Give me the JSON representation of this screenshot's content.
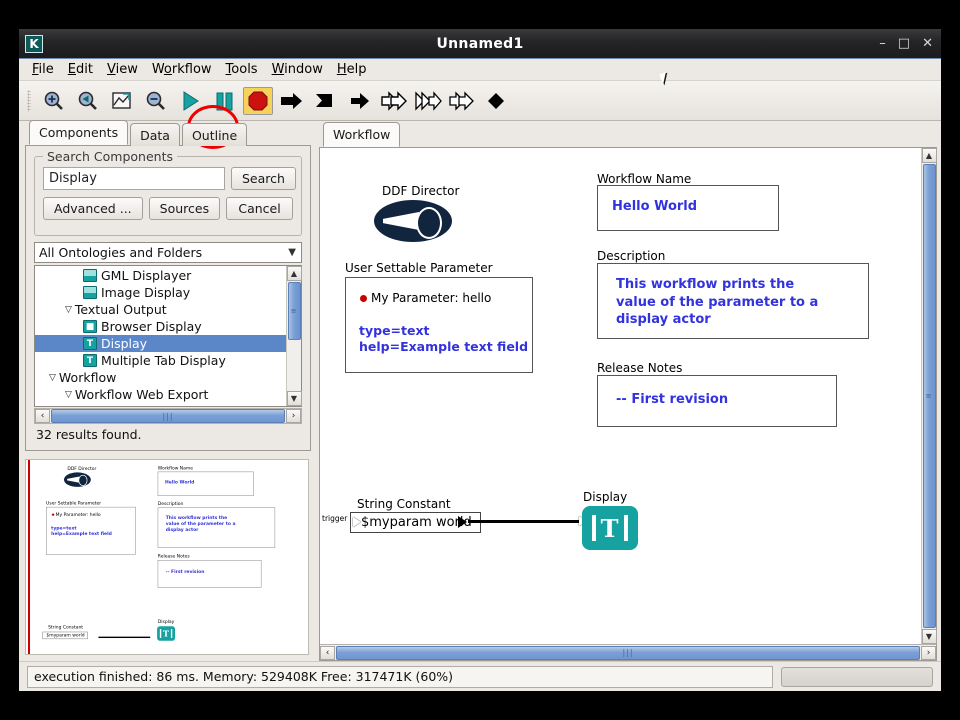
{
  "window": {
    "title": "Unnamed1",
    "app_icon": "K",
    "minimize": "–",
    "maximize": "□",
    "close": "✕"
  },
  "menubar": [
    {
      "label": "File",
      "mnemonic": "F"
    },
    {
      "label": "Edit",
      "mnemonic": "E"
    },
    {
      "label": "View",
      "mnemonic": "V"
    },
    {
      "label": "Workflow",
      "mnemonic": "W"
    },
    {
      "label": "Tools",
      "mnemonic": "T"
    },
    {
      "label": "Window",
      "mnemonic": "W"
    },
    {
      "label": "Help",
      "mnemonic": "H"
    }
  ],
  "toolbar": {
    "buttons": [
      {
        "name": "zoom-in-icon",
        "tip": "Zoom In"
      },
      {
        "name": "zoom-back-icon",
        "tip": "Zoom Reset"
      },
      {
        "name": "zoom-fit-icon",
        "tip": "Zoom Fit"
      },
      {
        "name": "zoom-out-icon",
        "tip": "Zoom Out"
      },
      {
        "name": "run-icon",
        "tip": "Run"
      },
      {
        "name": "pause-icon",
        "tip": "Pause"
      },
      {
        "name": "stop-icon",
        "tip": "Stop"
      },
      {
        "name": "step-icon",
        "tip": "Step"
      },
      {
        "name": "flag-icon",
        "tip": "Run to Breakpoint"
      },
      {
        "name": "step-into-icon",
        "tip": "Step Into"
      },
      {
        "name": "double-arrow-icon",
        "tip": "Step Over"
      },
      {
        "name": "skip-icon",
        "tip": "Skip"
      },
      {
        "name": "fast-forward-icon",
        "tip": "Fast Forward"
      },
      {
        "name": "diamond-icon",
        "tip": "Breakpoint"
      }
    ],
    "highlight_color": "#ee0000",
    "run_color": "#17a2a2",
    "stop_color": "#cc1111",
    "stop_bg": "#f7d25b"
  },
  "sidebar": {
    "tabs": [
      {
        "label": "Components",
        "active": true
      },
      {
        "label": "Data",
        "active": false
      },
      {
        "label": "Outline",
        "active": false
      }
    ],
    "search_group_title": "Search Components",
    "search_value": "Display",
    "search_placeholder": "Search Components",
    "search_button": "Search",
    "advanced_button": "Advanced ...",
    "sources_button": "Sources",
    "cancel_button": "Cancel",
    "ontology_selected": "All Ontologies and Folders",
    "tree": [
      {
        "label": "GML Displayer",
        "indent": 3,
        "icon": "image-icon",
        "twisty": "",
        "selected": false
      },
      {
        "label": "Image Display",
        "indent": 3,
        "icon": "image-icon",
        "twisty": "",
        "selected": false
      },
      {
        "label": "Textual Output",
        "indent": 2,
        "icon": "",
        "twisty": "▽",
        "selected": false
      },
      {
        "label": "Browser Display",
        "indent": 3,
        "icon": "browser-icon",
        "twisty": "",
        "selected": false
      },
      {
        "label": "Display",
        "indent": 3,
        "icon": "text-icon",
        "twisty": "",
        "selected": true
      },
      {
        "label": "Multiple Tab Display",
        "indent": 3,
        "icon": "text-icon",
        "twisty": "",
        "selected": false
      },
      {
        "label": "Workflow",
        "indent": 1,
        "icon": "",
        "twisty": "▽",
        "selected": false
      },
      {
        "label": "Workflow Web Export",
        "indent": 2,
        "icon": "",
        "twisty": "▽",
        "selected": false
      }
    ],
    "results_text": "32 results found.",
    "scroll_grip": "≡",
    "hscroll_grip": "|||",
    "arrow_up": "▲",
    "arrow_down": "▼",
    "arrow_left": "‹",
    "arrow_right": "›"
  },
  "canvas": {
    "tab_label": "Workflow",
    "director_label": "DDF Director",
    "parameter_title": "User Settable Parameter",
    "parameter_name": "My Parameter: hello",
    "parameter_type": "type=text",
    "parameter_help": "help=Example text field",
    "workflow_name_label": "Workflow Name",
    "workflow_name_value": "Hello World",
    "description_label": "Description",
    "description_value": "This workflow prints the\nvalue of the parameter to a\ndisplay actor",
    "release_notes_label": "Release Notes",
    "release_notes_value": "-- First revision",
    "string_constant_label": "String Constant",
    "string_constant_value": "$myparam world",
    "trigger_port_label": "trigger",
    "display_actor_label": "Display",
    "display_actor_glyph": "T",
    "annotation_color": "#3333dd",
    "actor_color": "#17a2a2",
    "director_color": "#12253f"
  },
  "statusbar": {
    "message": "execution finished: 86 ms. Memory: 529408K Free: 317471K (60%)",
    "progress_value": ""
  }
}
